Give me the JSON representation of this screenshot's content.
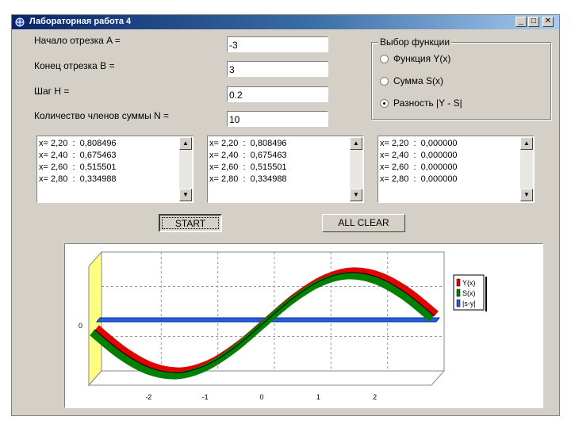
{
  "window": {
    "title": "Лабораторная работа 4",
    "min_label": "_",
    "max_label": "□",
    "close_label": "✕"
  },
  "form": {
    "start_label": "Начало отрезка A =",
    "start_value": "-3",
    "end_label": "Конец отрезка B =",
    "end_value": "3",
    "step_label": "Шаг H =",
    "step_value": "0.2",
    "count_label": "Количество членов суммы  N =",
    "count_value": "10"
  },
  "function_group": {
    "title": "Выбор функции",
    "options": [
      {
        "label": "Функция Y(x)",
        "selected": false
      },
      {
        "label": "Сумма S(x)",
        "selected": false
      },
      {
        "label": "Разность |Y - S|",
        "selected": true
      }
    ]
  },
  "lists": [
    {
      "rows": [
        "x= 2,20  :  0,808496",
        "x= 2,40  :  0,675463",
        "x= 2,60  :  0,515501",
        "x= 2,80  :  0,334988"
      ]
    },
    {
      "rows": [
        "x= 2,20  :  0,808496",
        "x= 2,40  :  0,675463",
        "x= 2,60  :  0,515501",
        "x= 2,80  :  0,334988"
      ]
    },
    {
      "rows": [
        "x= 2,20  :  0,000000",
        "x= 2,40  :  0,000000",
        "x= 2,60  :  0,000000",
        "x= 2,80  :  0,000000"
      ]
    }
  ],
  "buttons": {
    "start": "START",
    "clear": "ALL CLEAR"
  },
  "chart_data": {
    "type": "line",
    "title": "",
    "xlabel": "",
    "ylabel": "",
    "xlim": [
      -3,
      3
    ],
    "ylim": [
      -1,
      1
    ],
    "x_ticks": [
      "-2",
      "-1",
      "0",
      "1",
      "2"
    ],
    "y_ticks": [
      "0"
    ],
    "grid": true,
    "three_d": true,
    "legend_position": "right",
    "series": [
      {
        "name": "Y(x)",
        "color": "#e00000",
        "x": [
          -3,
          -2.5,
          -2,
          -1.5,
          -1,
          -0.5,
          0,
          0.5,
          1,
          1.5,
          2,
          2.5,
          3
        ],
        "y": [
          -0.14,
          -0.6,
          -0.91,
          -1.0,
          -0.84,
          -0.48,
          0,
          0.48,
          0.84,
          1.0,
          0.91,
          0.6,
          0.14
        ]
      },
      {
        "name": "S(x)",
        "color": "#008000",
        "x": [
          -3,
          -2.5,
          -2,
          -1.5,
          -1,
          -0.5,
          0,
          0.5,
          1,
          1.5,
          2,
          2.5,
          3
        ],
        "y": [
          -0.14,
          -0.6,
          -0.91,
          -1.0,
          -0.84,
          -0.48,
          0,
          0.48,
          0.84,
          1.0,
          0.91,
          0.6,
          0.14
        ]
      },
      {
        "name": "|s-y|",
        "color": "#2a5bd7",
        "x": [
          -3,
          3
        ],
        "y": [
          0,
          0
        ]
      }
    ]
  }
}
